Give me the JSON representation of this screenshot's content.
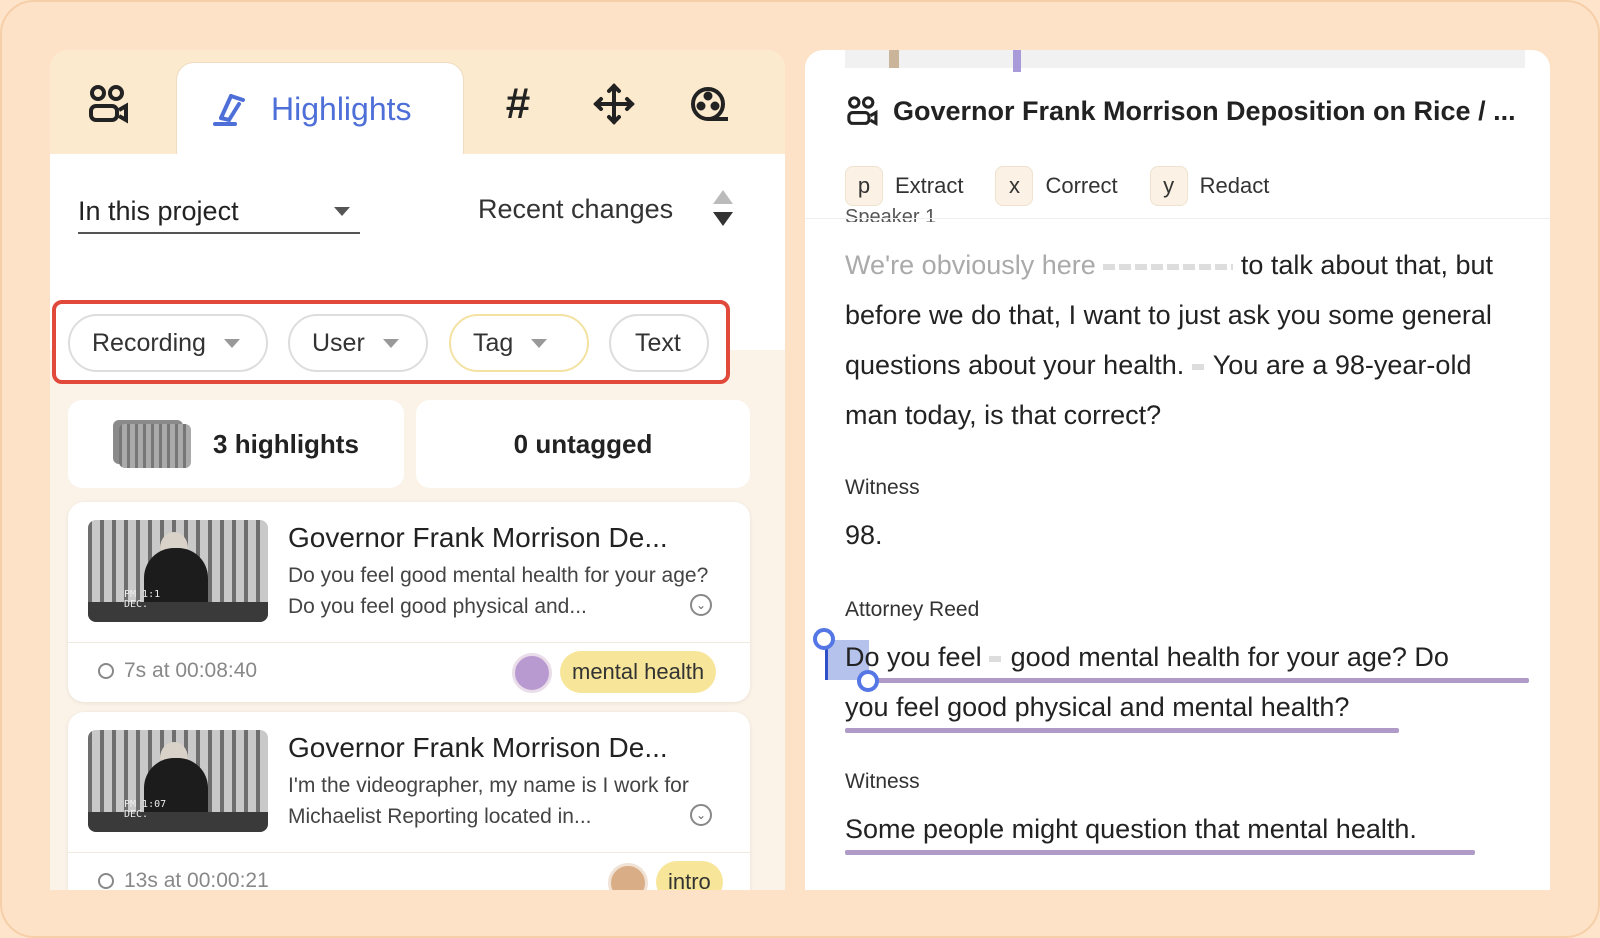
{
  "tabs": {
    "active_label": "Highlights",
    "hash_symbol": "#",
    "plus_symbol": "✛"
  },
  "filters_bar": {
    "scope": "In this project",
    "sort": "Recent changes",
    "chips": [
      "Recording",
      "User",
      "Tag",
      "Text"
    ]
  },
  "summary": {
    "highlights": "3 highlights",
    "untagged": "0 untagged"
  },
  "cards": [
    {
      "title": "Governor Frank Morrison De...",
      "text": "Do you feel good mental health for your age? Do you feel good physical and...",
      "stamp": "PM 1:1\nDEC.",
      "duration": "7s at 00:08:40",
      "avatar_color": "#b99ad0",
      "tag": "mental health"
    },
    {
      "title": "Governor Frank Morrison De...",
      "text": "I'm the videographer, my name is I work for Michaelist Reporting located in...",
      "stamp": "PM 1:07\nDEC.",
      "duration": "13s at 00:00:21",
      "avatar_color": "#d9ad86",
      "tag": "intro"
    }
  ],
  "document": {
    "title": "Governor Frank Morrison Deposition on Rice / ...",
    "shortcuts": [
      {
        "key": "p",
        "label": "Extract"
      },
      {
        "key": "x",
        "label": "Correct"
      },
      {
        "key": "y",
        "label": "Redact"
      }
    ],
    "clipped_speaker": "Speaker 1",
    "para1_faded": "We're obviously here",
    "para1_rest": "to talk about that, but before we do that, I want to just ask you some general questions about your health.",
    "para1_end": "You are a 98-year-old man today, is that correct?",
    "witness1": "Witness",
    "answer1": "98.",
    "attorney": "Attorney Reed",
    "q2_sel": "Do",
    "q2_a": " you feel",
    "q2_b": "good mental health for your age? Do",
    "q2_line2": "you feel good physical and mental health?",
    "witness2": "Witness",
    "answer2": "Some people might question that mental health."
  },
  "colors": {
    "accent": "#4e6fd8",
    "filter_outline": "#e14a3b",
    "highlight_underline": "#b09bc8",
    "tag_bg": "#f7e69a"
  }
}
